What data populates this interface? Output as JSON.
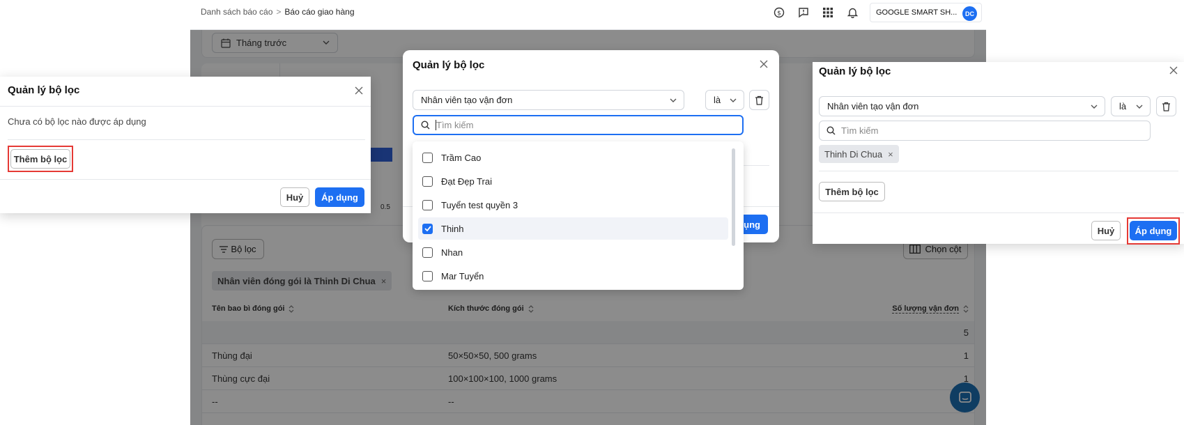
{
  "breadcrumb": {
    "parent": "Danh sách báo cáo",
    "separator": ">",
    "current": "Báo cáo giao hàng"
  },
  "header": {
    "shop_name": "GOOGLE SMART SH...",
    "avatar_initials": "DC",
    "icons": [
      "currency-exchange-icon",
      "feedback-icon",
      "apps-grid-icon",
      "bell-icon"
    ]
  },
  "date_filter": {
    "value": "Tháng trước"
  },
  "chart": {
    "tick_label": "0.5",
    "bar_color": "#2f5fd6"
  },
  "table": {
    "filter_button": "Bộ lọc",
    "columns_button": "Chọn cột",
    "applied_filter": "Nhân viên đóng gói là Thinh Di Chua",
    "headers": [
      "Tên bao bì đóng gói",
      "Kích thước đóng gói",
      "Số lượng vận đơn"
    ],
    "total": "5",
    "rows": [
      {
        "name": "Thùng đại",
        "size": "50×50×50, 500 grams",
        "count": "1"
      },
      {
        "name": "Thùng cực đại",
        "size": "100×100×100, 1000 grams",
        "count": "1"
      },
      {
        "name": "--",
        "size": "--",
        "count": ""
      }
    ]
  },
  "dialog_left": {
    "title": "Quản lý bộ lọc",
    "empty_text": "Chưa có bộ lọc nào được áp dụng",
    "add_button": "Thêm bộ lọc",
    "cancel": "Huỷ",
    "apply": "Áp dụng"
  },
  "dialog_center": {
    "title": "Quản lý bộ lọc",
    "field_select": "Nhân viên tạo vận đơn",
    "operator_select": "là",
    "search_placeholder": "Tìm kiếm",
    "apply_partial": "dụng",
    "options": [
      {
        "label": "Trầm Cao",
        "checked": false
      },
      {
        "label": "Đạt Đẹp Trai",
        "checked": false
      },
      {
        "label": "Tuyển test quyền 3",
        "checked": false
      },
      {
        "label": "Thinh",
        "checked": true
      },
      {
        "label": "Nhan",
        "checked": false
      },
      {
        "label": "Mar Tuyển",
        "checked": false
      }
    ]
  },
  "dialog_right": {
    "title": "Quản lý bộ lọc",
    "field_select": "Nhân viên tạo vận đơn",
    "operator_select": "là",
    "search_placeholder": "Tìm kiếm",
    "selected_chip": "Thinh Di Chua",
    "add_button": "Thêm bộ lọc",
    "cancel": "Huỷ",
    "apply": "Áp dụng"
  },
  "colors": {
    "primary": "#1d6ff2",
    "highlight_box": "#e53935",
    "overlay": "rgba(0,0,0,0.45)"
  }
}
